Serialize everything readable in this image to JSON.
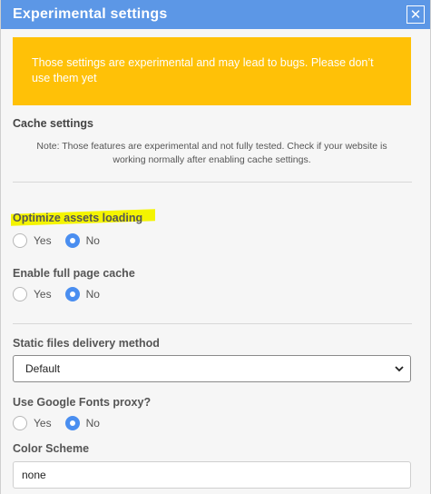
{
  "dialog": {
    "title": "Experimental settings",
    "close_label": "✕"
  },
  "warning": {
    "text": "Those settings are experimental and may lead to bugs. Please don’t use them yet"
  },
  "cache": {
    "title": "Cache settings",
    "note": "Note: Those features are experimental and not fully tested. Check if your website is working normally after enabling cache settings."
  },
  "optimize_assets": {
    "label": "Optimize assets loading",
    "yes": "Yes",
    "no": "No",
    "selected": "No"
  },
  "full_page_cache": {
    "label": "Enable full page cache",
    "yes": "Yes",
    "no": "No",
    "selected": "No"
  },
  "static_delivery": {
    "label": "Static files delivery method",
    "value": "Default"
  },
  "google_fonts": {
    "label": "Use Google Fonts proxy?",
    "yes": "Yes",
    "no": "No",
    "selected": "No"
  },
  "color_scheme": {
    "label": "Color Scheme",
    "value": "none"
  },
  "colors": {
    "titlebar": "#5c97e6",
    "warning": "#ffc107",
    "radio_checked": "#4a8ef0",
    "highlight": "#f4f400"
  }
}
